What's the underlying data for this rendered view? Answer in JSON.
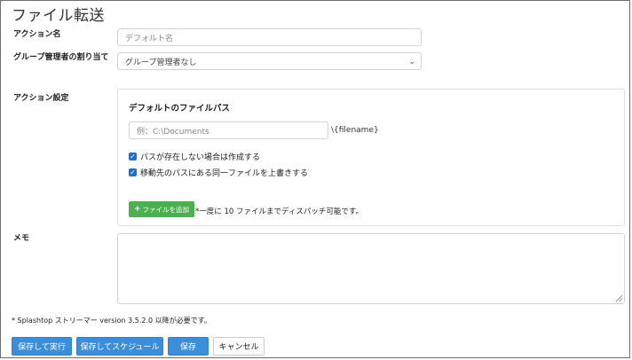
{
  "page": {
    "title": "ファイル転送"
  },
  "form": {
    "action_name": {
      "label": "アクション名",
      "placeholder": "デフォルト名"
    },
    "group_admin": {
      "label": "グループ管理者の割り当て",
      "selected": "グループ管理者なし"
    },
    "action_settings": {
      "label": "アクション設定",
      "heading": "デフォルトのファイルパス",
      "path_placeholder": "例：C:\\Documents",
      "filename_suffix": "\\{filename}",
      "checkboxes": [
        {
          "label": "パスが存在しない場合は作成する",
          "checked": true
        },
        {
          "label": "移動先のパスにある同一ファイルを上書きする",
          "checked": true
        }
      ],
      "add_file_label": "ファイルを追加",
      "add_file_note": "*一度に 10 ファイルまでディスパッチ可能です。"
    },
    "memo": {
      "label": "メモ",
      "value": ""
    }
  },
  "footnote": "* Splashtop ストリーマー version 3.5.2.0 以降が必要です。",
  "buttons": {
    "save_run": "保存して実行",
    "save_schedule": "保存してスケジュール",
    "save": "保存",
    "cancel": "キャンセル"
  },
  "colors": {
    "primary": "#3d8ed8",
    "add_button": "#4caf50",
    "checkbox": "#1f6fd1"
  }
}
